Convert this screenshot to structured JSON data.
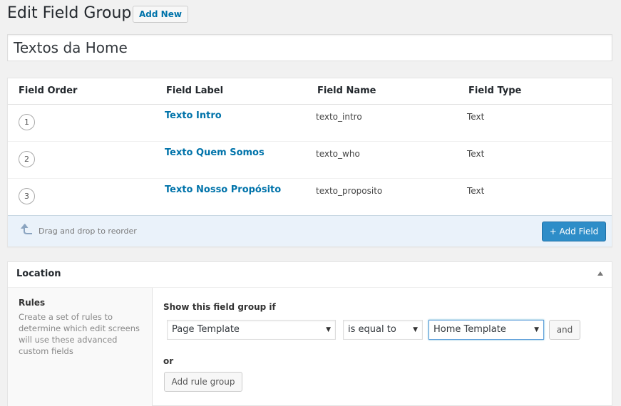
{
  "header": {
    "title": "Edit Field Group",
    "add_new_label": "Add New"
  },
  "title_input": {
    "value": "Textos da Home"
  },
  "fields_table": {
    "columns": [
      "Field Order",
      "Field Label",
      "Field Name",
      "Field Type"
    ],
    "rows": [
      {
        "order": "1",
        "label": "Texto Intro",
        "name": "texto_intro",
        "type": "Text"
      },
      {
        "order": "2",
        "label": "Texto Quem Somos",
        "name": "texto_who",
        "type": "Text"
      },
      {
        "order": "3",
        "label": "Texto Nosso Propósito",
        "name": "texto_proposito",
        "type": "Text"
      }
    ],
    "footer": {
      "drag_hint": "Drag and drop to reorder",
      "add_field_label": "+ Add Field"
    }
  },
  "location": {
    "title": "Location",
    "rules_title": "Rules",
    "rules_description": "Create a set of rules to determine which edit screens will use these advanced custom fields",
    "show_if_label": "Show this field group if",
    "param_select": "Page Template",
    "operator_select": "is equal to",
    "value_select": "Home Template",
    "and_label": "and",
    "or_label": "or",
    "add_rule_group_label": "Add rule group"
  },
  "colors": {
    "link": "#0073aa",
    "primary_button": "#2e8dc8",
    "footer_bg": "#eaf2fa",
    "page_bg": "#f1f1f1"
  },
  "icons": {
    "drag": "curved-up-arrow-icon",
    "collapse": "triangle-up-icon",
    "select_arrow": "dropdown-arrow-icon"
  }
}
